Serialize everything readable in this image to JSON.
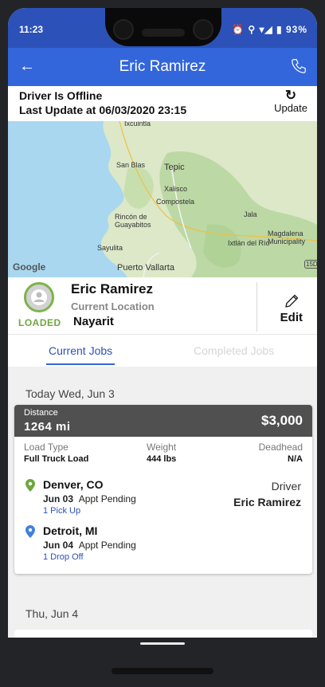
{
  "statusbar": {
    "time": "11:23",
    "indicators": "⏰ ⚲ ▾◢ ▮ 93%"
  },
  "appbar": {
    "title": "Eric Ramirez",
    "back_icon": "arrow-left-icon",
    "call_icon": "phone-icon"
  },
  "status": {
    "offline": "Driver Is Offline",
    "last_update": "Last Update at 06/03/2020 23:15",
    "update_label": "Update"
  },
  "map": {
    "places": [
      "Ixcuintla",
      "San Blas",
      "Tepic",
      "Xalisco",
      "Compostela",
      "Jala",
      "Rincón de Guayabitos",
      "Sayulita",
      "Ixtlán del Río",
      "Magdalena Municipality",
      "Puerto Vallarta",
      "15D"
    ],
    "google": "Google"
  },
  "driver": {
    "status_badge": "LOADED",
    "name": "Eric Ramirez",
    "location_label": "Current Location",
    "location": "Nayarit",
    "edit_label": "Edit"
  },
  "tabs": {
    "current": "Current Jobs",
    "completed": "Completed Jobs"
  },
  "jobs": {
    "day1": "Today Wed, Jun 3",
    "day2": "Thu, Jun 4",
    "card": {
      "distance_label": "Distance",
      "distance_value": "1264  mi",
      "price": "$3,000",
      "load_type_label": "Load Type",
      "load_type": "Full Truck Load",
      "weight_label": "Weight",
      "weight": "444  lbs",
      "deadhead_label": "Deadhead",
      "deadhead": "N/A",
      "pickup": {
        "city": "Denver, CO",
        "date": "Jun 03",
        "status": "Appt Pending",
        "action": "1 Pick Up",
        "pin_color": "#6fa640"
      },
      "dropoff": {
        "city": "Detroit, MI",
        "date": "Jun 04",
        "status": "Appt Pending",
        "action": "1 Drop Off",
        "pin_color": "#3f80e0"
      },
      "driver_label": "Driver",
      "driver_name": "Eric Ramirez"
    }
  },
  "colors": {
    "status_bar": "#2c51b8",
    "app_bar": "#3366db",
    "loaded": "#6fa640",
    "link": "#2c51b8"
  }
}
